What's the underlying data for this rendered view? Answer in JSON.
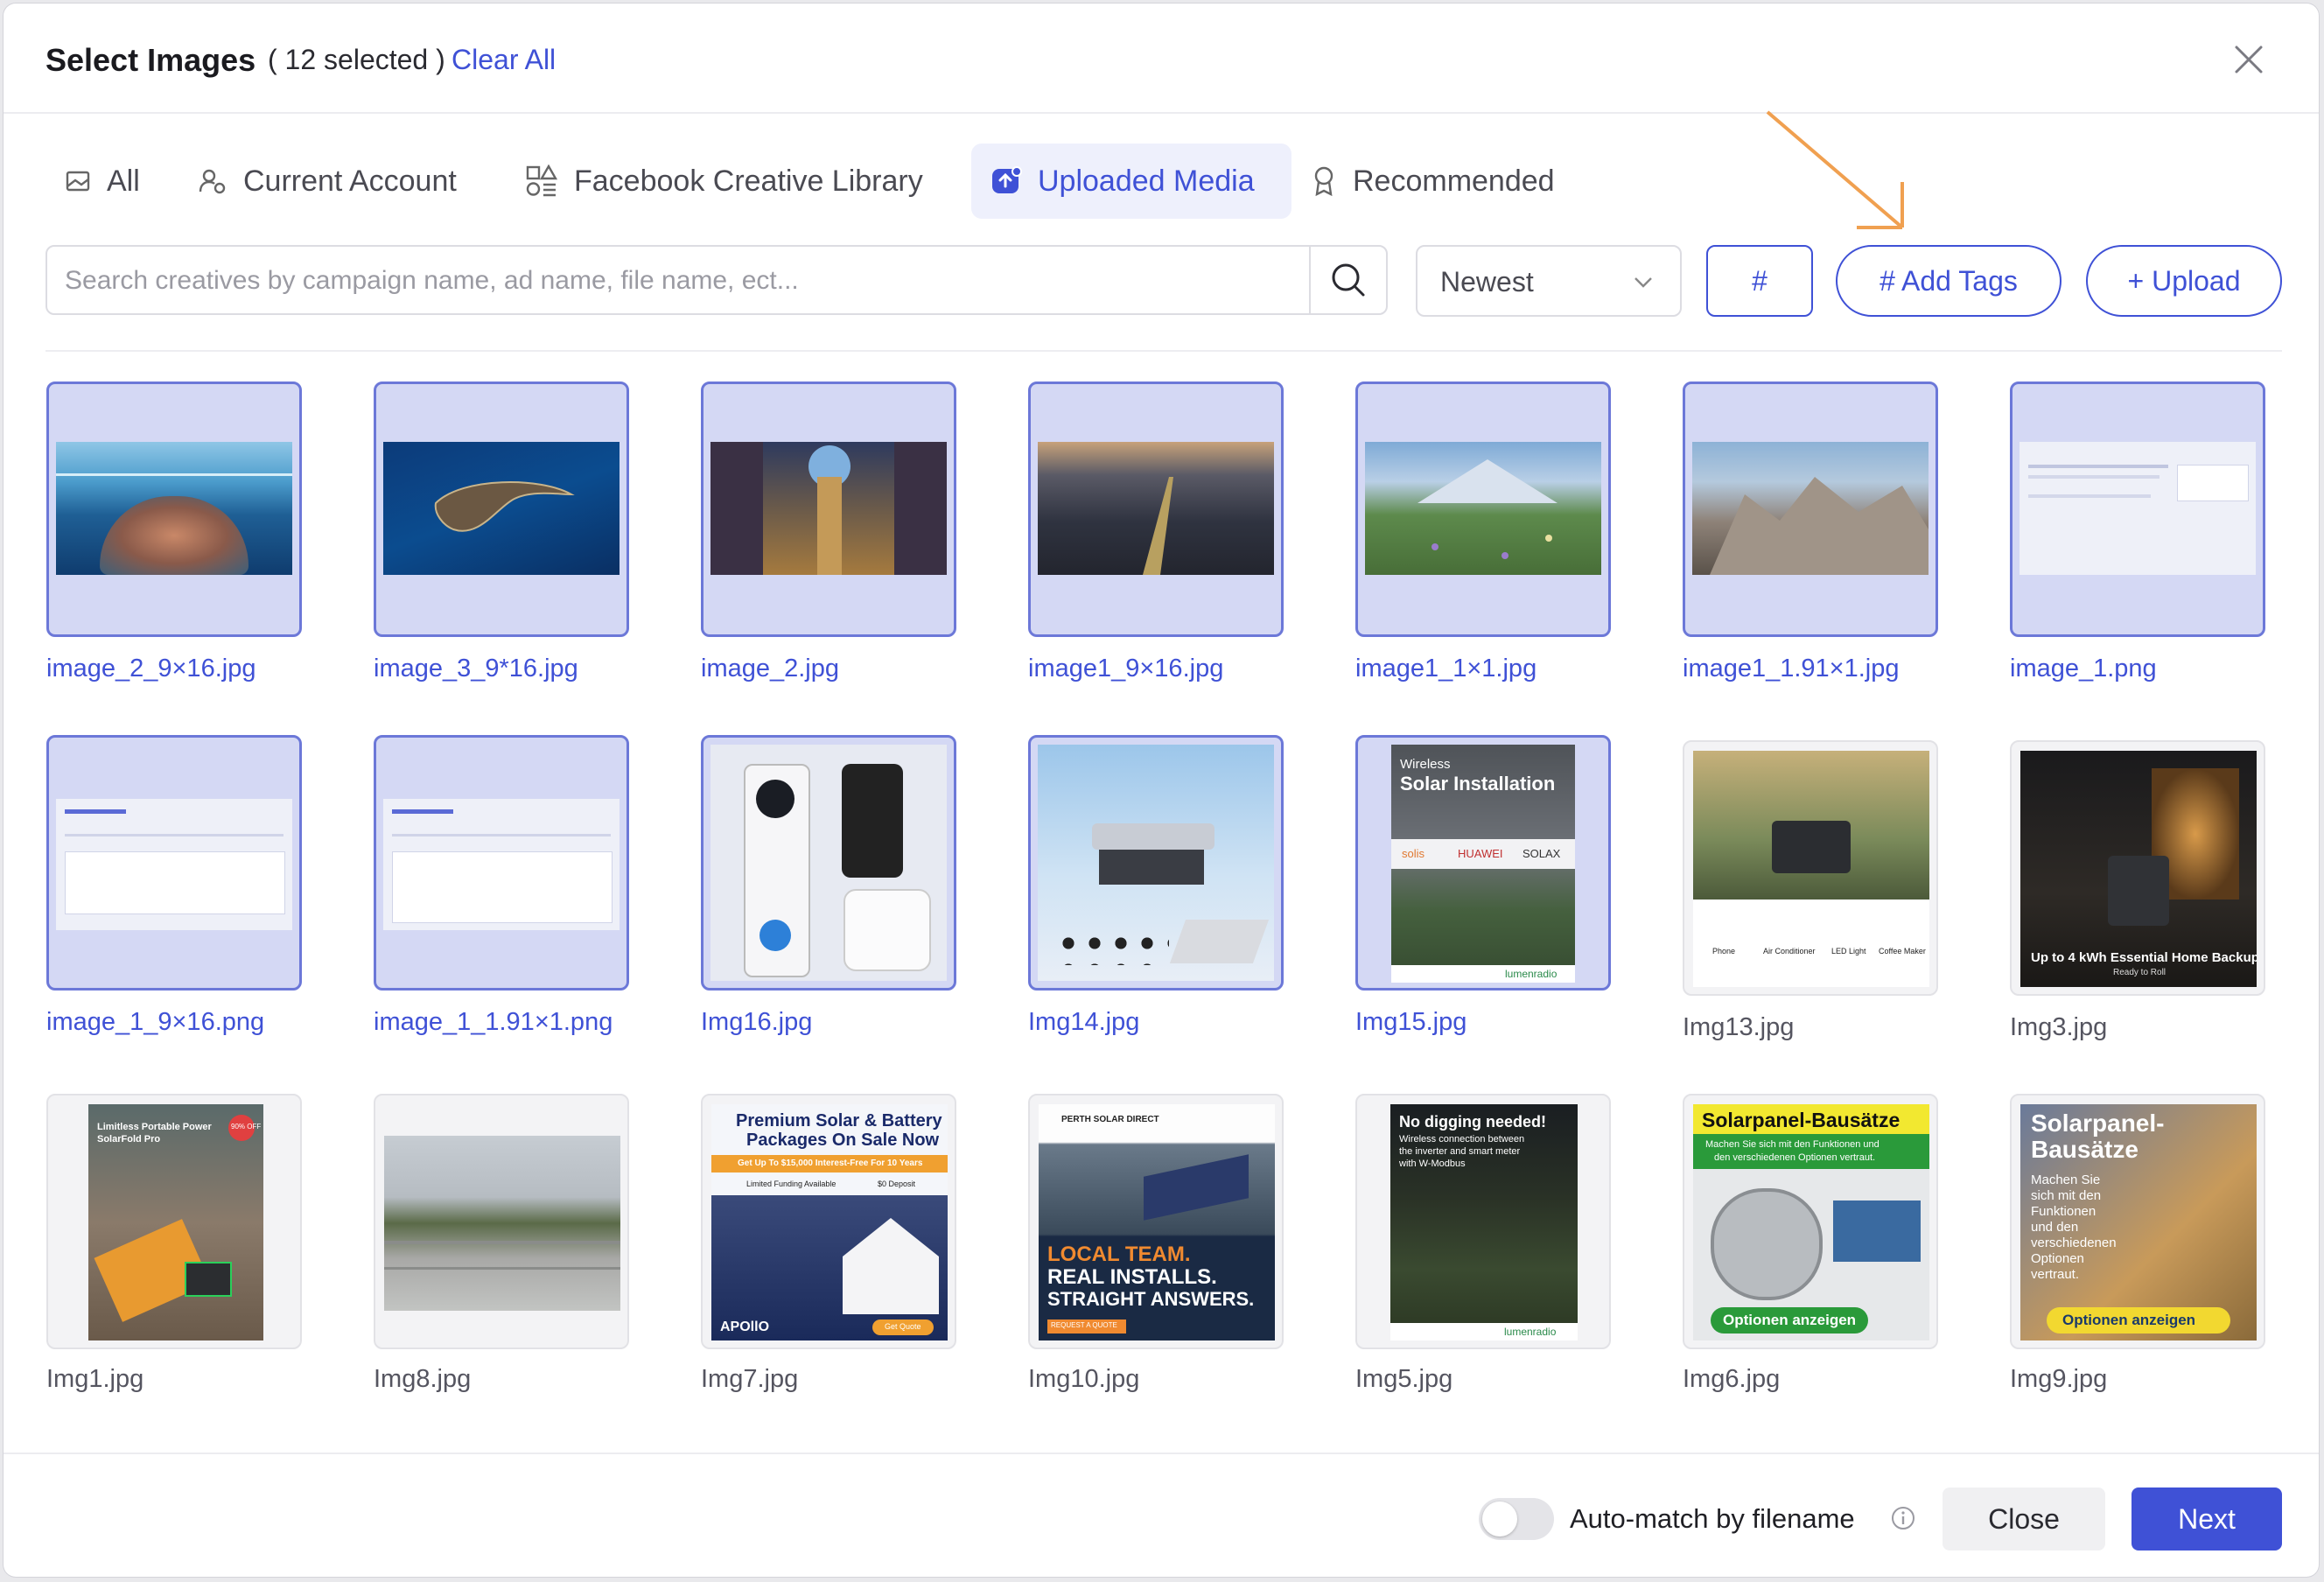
{
  "header": {
    "title": "Select Images",
    "selected_count": "( 12 selected )",
    "clear_all": "Clear All"
  },
  "tabs": [
    {
      "label": "All",
      "icon": "image-icon"
    },
    {
      "label": "Current Account",
      "icon": "account-settings-icon"
    },
    {
      "label": "Facebook Creative Library",
      "icon": "library-shapes-icon"
    },
    {
      "label": "Uploaded Media",
      "icon": "upload-cloud-icon",
      "active": true
    },
    {
      "label": "Recommended",
      "icon": "award-ribbon-icon"
    }
  ],
  "toolbar": {
    "search_placeholder": "Search creatives by campaign name, ad name, file name, ect...",
    "sort_value": "Newest",
    "hash_label": "#",
    "add_tags_label": "# Add Tags",
    "upload_label": "+ Upload"
  },
  "items": [
    {
      "name": "image_2_9×16.jpg",
      "selected": true
    },
    {
      "name": "image_3_9*16.jpg",
      "selected": true
    },
    {
      "name": "image_2.jpg",
      "selected": true
    },
    {
      "name": "image1_9×16.jpg",
      "selected": true
    },
    {
      "name": "image1_1×1.jpg",
      "selected": true
    },
    {
      "name": "image1_1.91×1.jpg",
      "selected": true
    },
    {
      "name": "image_1.png",
      "selected": true
    },
    {
      "name": "image_1_9×16.png",
      "selected": true
    },
    {
      "name": "image_1_1.91×1.png",
      "selected": true
    },
    {
      "name": "Img16.jpg",
      "selected": true
    },
    {
      "name": "Img14.jpg",
      "selected": true
    },
    {
      "name": "Img15.jpg",
      "selected": true
    },
    {
      "name": "Img13.jpg",
      "selected": false
    },
    {
      "name": "Img3.jpg",
      "selected": false
    },
    {
      "name": "Img1.jpg",
      "selected": false
    },
    {
      "name": "Img8.jpg",
      "selected": false
    },
    {
      "name": "Img7.jpg",
      "selected": false
    },
    {
      "name": "Img10.jpg",
      "selected": false
    },
    {
      "name": "Img5.jpg",
      "selected": false
    },
    {
      "name": "Img6.jpg",
      "selected": false
    },
    {
      "name": "Img9.jpg",
      "selected": false
    }
  ],
  "thumb_text": {
    "img15_a": "Wireless",
    "img15_b": "Solar Installation",
    "img15_c": "solis",
    "img15_d": "HUAWEI",
    "img15_e": "SOLAX",
    "img15_f": "lumenradio",
    "img13_a": "Phone",
    "img13_b": "Air Conditioner",
    "img13_c": "LED Light",
    "img13_d": "Coffee Maker",
    "img3_a": "Up to 4 kWh Essential Home Backup",
    "img3_b": "Ready to Roll",
    "img1_a": "Limitless Portable Power",
    "img1_b": "SolarFold Pro",
    "img1_c": "90% OFF",
    "img7_a": "Premium Solar & Battery",
    "img7_b": "Packages On Sale Now",
    "img7_c": "Get Up To $15,000 Interest-Free For 10 Years",
    "img7_d": "Limited Funding Available",
    "img7_e": "$0 Deposit",
    "img7_f": "APOllO",
    "img7_g": "Get Quote",
    "img10_a": "PERTH SOLAR DIRECT",
    "img10_b": "LOCAL TEAM.",
    "img10_c": "REAL INSTALLS.",
    "img10_d": "STRAIGHT ANSWERS.",
    "img10_e": "REQUEST A QUOTE",
    "img5_a": "No digging needed!",
    "img5_b": "Wireless connection between",
    "img5_c": "the inverter and smart meter",
    "img5_d": "with W-Modbus",
    "img5_e": "lumenradio",
    "img6_a": "Solarpanel-Bausätze",
    "img6_b": "Machen Sie sich mit den Funktionen und",
    "img6_c": "den verschiedenen Optionen vertraut.",
    "img6_d": "Optionen anzeigen",
    "img9_a": "Solarpanel-",
    "img9_b": "Bausätze",
    "img9_c": "Machen Sie",
    "img9_d": "sich mit den",
    "img9_e": "Funktionen",
    "img9_f": "und den",
    "img9_g": "verschiedenen",
    "img9_h": "Optionen",
    "img9_i": "vertraut.",
    "img9_j": "Optionen anzeigen"
  },
  "footer": {
    "auto_match_label": "Auto-match by filename",
    "close_label": "Close",
    "next_label": "Next"
  },
  "colors": {
    "accent": "#3f51d6",
    "selected_bg": "#d4d8f4",
    "annotation_arrow": "#f0a050"
  }
}
